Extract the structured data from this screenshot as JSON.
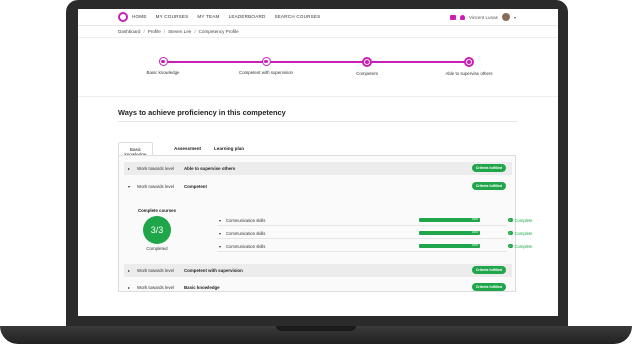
{
  "nav": {
    "links": [
      "HOME",
      "MY COURSES",
      "MY TEAM",
      "LEADERBOARD",
      "SEARCH COURSES"
    ],
    "user_name": "Vincent Lunas",
    "caret": "▾",
    "logo_color": "#c81fb8"
  },
  "breadcrumb": [
    "Dashboard",
    "Profile",
    "Steven Lee",
    "Competency Profile"
  ],
  "breadcrumb_sep": "/",
  "progress": {
    "stages": [
      "Basic knowledge",
      "Competent with supervision",
      "Competent",
      "Able to supervise others"
    ],
    "accent": "#c81fb8"
  },
  "section_title": "Ways to achieve proficiency in this competency",
  "tabs": [
    "Basic knowledge",
    "Assessment",
    "Learning plan"
  ],
  "rows": [
    {
      "label": "Work towards level",
      "level": "Able to supervise others",
      "button": "Criteria fulfilled"
    },
    {
      "label": "Work towards level",
      "level": "Competent",
      "button": "Criteria fulfilled"
    },
    {
      "label": "Work towards level",
      "level": "Competent with supervision",
      "button": "Criteria fulfilled"
    },
    {
      "label": "Work towards level",
      "level": "Basic knowledge",
      "button": "Criteria fulfilled"
    }
  ],
  "complete_courses": {
    "title": "Complete courses",
    "count": "3/3",
    "subtitle": "Completed"
  },
  "courses": [
    {
      "name": "Communication skills",
      "progress": 1.0,
      "progress_text": "100%",
      "status": "Complete"
    },
    {
      "name": "Communication skills",
      "progress": 1.0,
      "progress_text": "100%",
      "status": "Complete"
    },
    {
      "name": "Communication skills",
      "progress": 1.0,
      "progress_text": "100%",
      "status": "Complete"
    }
  ],
  "icons": {
    "collapse": "▾",
    "expand": "▸",
    "check": "✓"
  },
  "colors": {
    "success": "#1fa64a",
    "accent": "#c81fb8"
  }
}
